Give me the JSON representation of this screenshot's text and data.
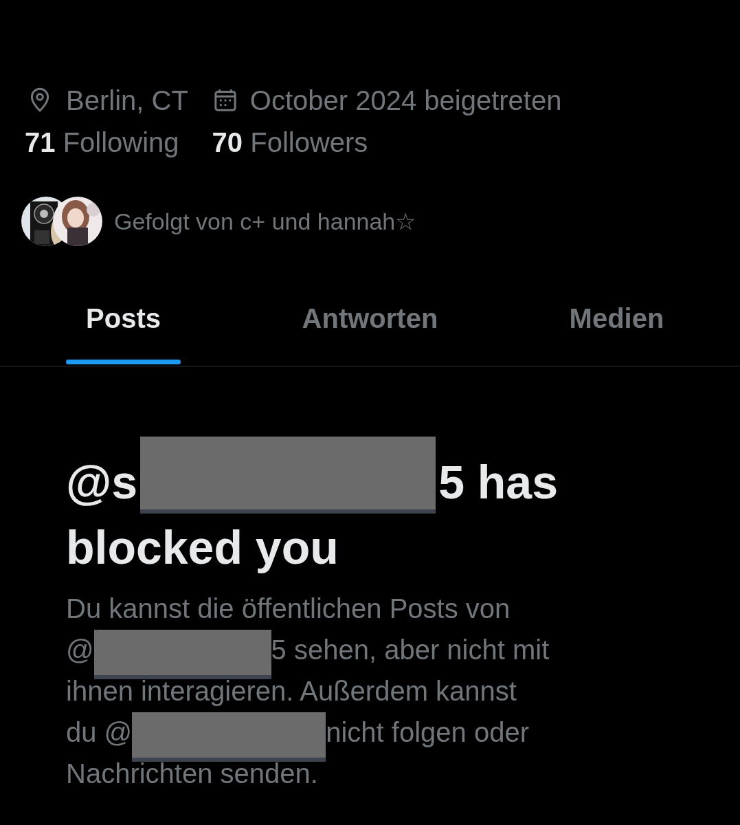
{
  "profile": {
    "location": "Berlin, CT",
    "joined": "October 2024 beigetreten"
  },
  "stats": [
    {
      "count": "71",
      "label": "Following"
    },
    {
      "count": "70",
      "label": "Followers"
    }
  ],
  "followed_by": {
    "text": "Gefolgt von c+ und hannah☆"
  },
  "tabs": [
    {
      "label": "Posts",
      "selected": true
    },
    {
      "label": "Antworten",
      "selected": false
    },
    {
      "label": "Medien",
      "selected": false
    }
  ],
  "notice": {
    "title_lines": [
      [
        {
          "kind": "text",
          "text": "@s"
        },
        {
          "kind": "redaction"
        },
        {
          "kind": "text",
          "text": "5 has"
        }
      ],
      [
        {
          "kind": "text",
          "text": "blocked you"
        }
      ]
    ],
    "body_lines": [
      [
        {
          "kind": "text",
          "text": "Du kannst die öffentlichen Posts von"
        }
      ],
      [
        {
          "kind": "text",
          "text": "@"
        },
        {
          "kind": "redaction"
        },
        {
          "kind": "text",
          "text": "5 sehen, aber nicht mit"
        }
      ],
      [
        {
          "kind": "text",
          "text": "ihnen interagieren. Außerdem kannst"
        }
      ],
      [
        {
          "kind": "text",
          "text": "du @"
        },
        {
          "kind": "redaction"
        },
        {
          "kind": "text",
          "text": "nicht folgen oder"
        }
      ],
      [
        {
          "kind": "text",
          "text": "Nachrichten senden."
        }
      ]
    ]
  }
}
